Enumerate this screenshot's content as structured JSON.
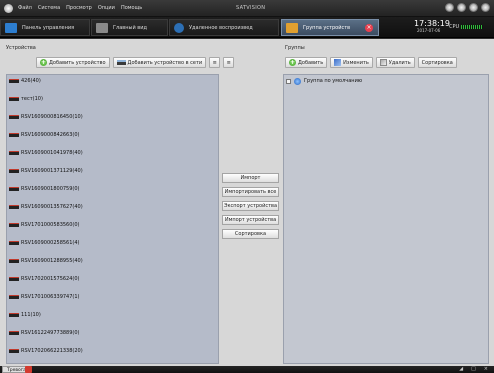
{
  "app": {
    "brand": "SATVISION",
    "menu": [
      "Файл",
      "Система",
      "Просмотр",
      "Опции",
      "Помощь"
    ]
  },
  "tabs": [
    {
      "label": "Панель управления",
      "icon": "control-panel-icon",
      "color": "#2d7ed0"
    },
    {
      "label": "Главный вид",
      "icon": "monitor-icon",
      "color": "#8a8a8a"
    },
    {
      "label": "Удаленное воспроизвед",
      "icon": "playback-icon",
      "color": "#2c6fb5"
    },
    {
      "label": "Группа устройств",
      "icon": "device-group-icon",
      "color": "#e0a030"
    }
  ],
  "status": {
    "time": "17:38:19",
    "date": "2017-07-06",
    "cpu_label": "CPU"
  },
  "devices_panel": {
    "title": "Устройства",
    "add_device": "Добавить устройство",
    "add_network_device": "Добавить устройство в сети",
    "items": [
      "426(40)",
      "тест(10)",
      "RSV1609000816450(10)",
      "RSV1609000842663(0)",
      "RSV1609001041978(40)",
      "RSV1609001371129(40)",
      "RSV1609001800759(0)",
      "RSV1609001357627(40)",
      "RSV1701000583560(0)",
      "RSV1609000258561(4)",
      "RSV1609001288955(40)",
      "RSV1702001575624(0)",
      "RSV1701006339747(1)",
      "111(10)",
      "RSV1612249773889(0)",
      "RSV1702066221338(20)"
    ]
  },
  "middle_buttons": [
    "Импорт",
    "Импортировать все",
    "Экспорт устройства",
    "Импорт устройства",
    "Сортировка"
  ],
  "groups_panel": {
    "title": "Группы",
    "add": "Добавить",
    "edit": "Изменить",
    "delete": "Удалить",
    "sort": "Сортировка",
    "items": [
      "Группа по умолчанию"
    ]
  },
  "bottom": {
    "alarm_tab": "Тревога"
  }
}
